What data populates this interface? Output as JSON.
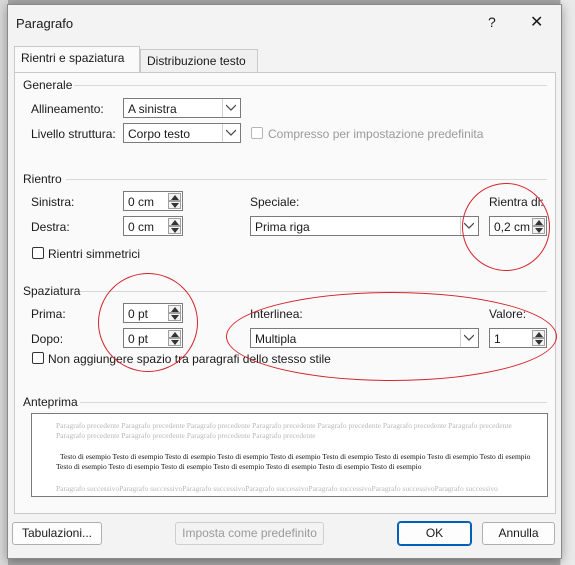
{
  "window": {
    "title": "Paragrafo",
    "help": "?",
    "close": "✕"
  },
  "tabs": [
    {
      "label": "Rientri e spaziatura",
      "active": true
    },
    {
      "label": "Distribuzione testo",
      "active": false
    }
  ],
  "generale": {
    "section": "Generale",
    "allineamento_label": "Allineamento:",
    "allineamento_value": "A sinistra",
    "livello_label": "Livello struttura:",
    "livello_value": "Corpo testo",
    "compresso_label": "Compresso per impostazione predefinita"
  },
  "rientro": {
    "section": "Rientro",
    "sinistra_label": "Sinistra:",
    "sinistra_value": "0 cm",
    "destra_label": "Destra:",
    "destra_value": "0 cm",
    "speciale_label": "Speciale:",
    "speciale_value": "Prima riga",
    "rientra_label": "Rientra di:",
    "rientra_value": "0,2 cm",
    "simmetrici_label": "Rientri simmetrici"
  },
  "spaziatura": {
    "section": "Spaziatura",
    "prima_label": "Prima:",
    "prima_value": "0 pt",
    "dopo_label": "Dopo:",
    "dopo_value": "0 pt",
    "interlinea_label": "Interlinea:",
    "interlinea_value": "Multipla",
    "valore_label": "Valore:",
    "valore_value": "1",
    "non_aggiungere_label": "Non aggiungere spazio tra paragrafi dello stesso stile"
  },
  "anteprima": {
    "section": "Anteprima",
    "previous": "Paragrafo precedente Paragrafo precedente Paragrafo precedente Paragrafo precedente Paragrafo precedente Paragrafo precedente Paragrafo precedente Paragrafo precedente Paragrafo precedente Paragrafo precedente Paragrafo precedente",
    "current": "Testo di esempio Testo di esempio Testo di esempio Testo di esempio Testo di esempio Testo di esempio Testo di esempio Testo di esempio Testo di esempio Testo di esempio Testo di esempio Testo di esempio Testo di esempio Testo di esempio Testo di esempio Testo di esempio",
    "next": "Paragrafo successivoParagrafo successivoParagrafo successivoParagrafo successivoParagrafo successivoParagrafo successivoParagrafo successivo"
  },
  "buttons": {
    "tabulazioni": "Tabulazioni...",
    "imposta": "Imposta come predefinito",
    "ok": "OK",
    "annulla": "Annulla"
  },
  "colors": {
    "annotation": "#d4232a",
    "accent": "#005fb8"
  }
}
